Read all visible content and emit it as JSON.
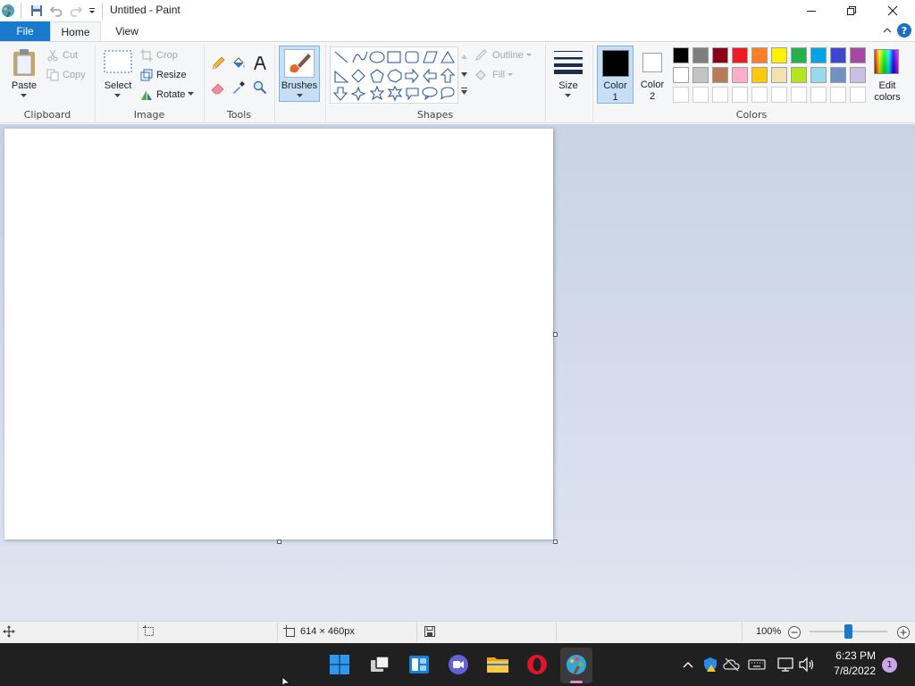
{
  "window": {
    "title": "Untitled - Paint"
  },
  "menu": {
    "file": "File",
    "home": "Home",
    "view": "View"
  },
  "clipboard": {
    "paste": "Paste",
    "cut": "Cut",
    "copy": "Copy",
    "group": "Clipboard"
  },
  "image": {
    "select": "Select",
    "crop": "Crop",
    "resize": "Resize",
    "rotate": "Rotate",
    "group": "Image"
  },
  "tools": {
    "group": "Tools"
  },
  "brushes": {
    "label": "Brushes"
  },
  "shapes": {
    "outline": "Outline",
    "fill": "Fill",
    "group": "Shapes"
  },
  "size": {
    "label": "Size"
  },
  "color1": {
    "label1": "Color",
    "label2": "1",
    "value": "#000000"
  },
  "color2": {
    "label1": "Color",
    "label2": "2",
    "value": "#ffffff"
  },
  "colors": {
    "group": "Colors",
    "row1": [
      "#000000",
      "#7f7f7f",
      "#880015",
      "#ed1c24",
      "#ff7f27",
      "#fff200",
      "#22b14c",
      "#00a2e8",
      "#3f48cc",
      "#a349a4"
    ],
    "row2": [
      "#ffffff",
      "#c3c3c3",
      "#b97a57",
      "#ffaec9",
      "#ffc90e",
      "#efe4b0",
      "#b5e61d",
      "#99d9ea",
      "#7092be",
      "#c8bfe7"
    ],
    "edit1": "Edit",
    "edit2": "colors"
  },
  "status": {
    "canvas_size": "614 × 460px",
    "zoom": "100%"
  },
  "zoom_level": 0.5,
  "taskbar": {
    "time": "6:23 PM",
    "date": "7/8/2022",
    "badge": "1"
  }
}
